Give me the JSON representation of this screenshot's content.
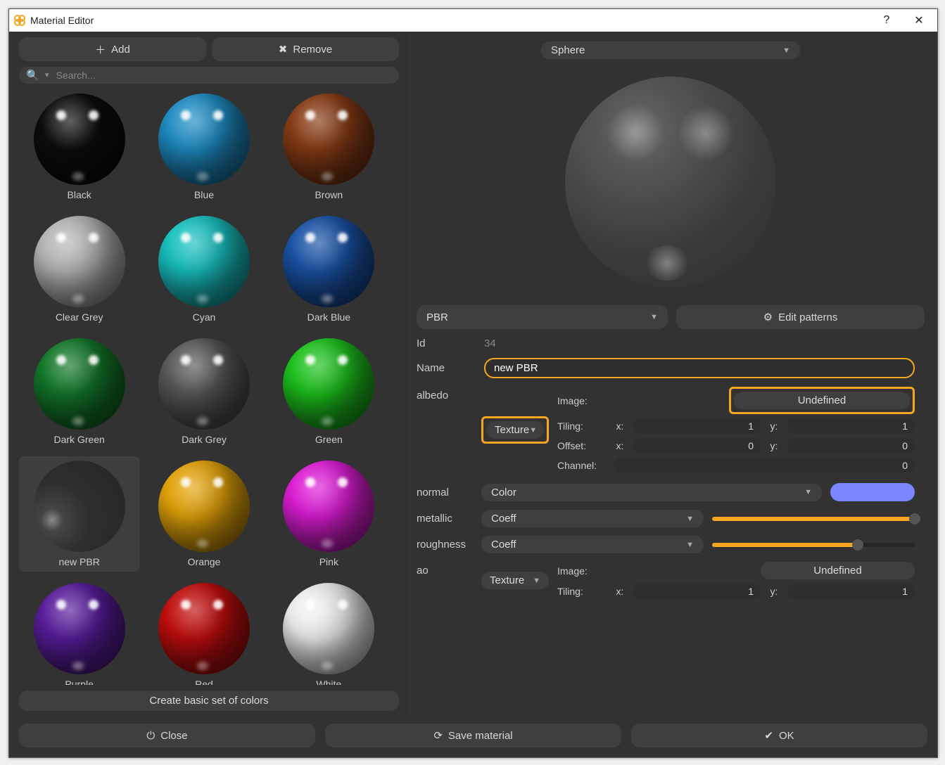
{
  "window": {
    "title": "Material Editor"
  },
  "left": {
    "add_label": "Add",
    "remove_label": "Remove",
    "search_placeholder": "Search...",
    "create_label": "Create basic set of colors",
    "materials": [
      {
        "name": "Black",
        "color": "#0d0d0d",
        "selected": false
      },
      {
        "name": "Blue",
        "color": "#1f8ec6",
        "selected": false
      },
      {
        "name": "Brown",
        "color": "#8a3d16",
        "selected": false
      },
      {
        "name": "Clear Grey",
        "color": "#b9b9b9",
        "selected": false
      },
      {
        "name": "Cyan",
        "color": "#19c3c3",
        "selected": false
      },
      {
        "name": "Dark Blue",
        "color": "#1a54a8",
        "selected": false
      },
      {
        "name": "Dark Green",
        "color": "#147a2a",
        "selected": false
      },
      {
        "name": "Dark Grey",
        "color": "#5a5a5a",
        "selected": false
      },
      {
        "name": "Green",
        "color": "#1ec41e",
        "selected": false
      },
      {
        "name": "new PBR",
        "color": "#3a3a3a",
        "selected": true,
        "matte": true
      },
      {
        "name": "Orange",
        "color": "#e5a50a",
        "selected": false
      },
      {
        "name": "Pink",
        "color": "#e01ed8",
        "selected": false
      },
      {
        "name": "Purple",
        "color": "#5a1e9e",
        "selected": false
      },
      {
        "name": "Red",
        "color": "#c40e0e",
        "selected": false
      },
      {
        "name": "White",
        "color": "#f2f2f2",
        "selected": false
      }
    ]
  },
  "right": {
    "preview_shape": "Sphere",
    "material_type": "PBR",
    "edit_patterns_label": "Edit patterns",
    "id_label": "Id",
    "id_value": "34",
    "name_label": "Name",
    "name_value": "new PBR",
    "albedo": {
      "label": "albedo",
      "mode": "Texture",
      "image_label": "Image:",
      "image_value": "Undefined",
      "tiling_label": "Tiling:",
      "tiling_x": "1",
      "tiling_y": "1",
      "offset_label": "Offset:",
      "offset_x": "0",
      "offset_y": "0",
      "channel_label": "Channel:",
      "channel": "0"
    },
    "normal": {
      "label": "normal",
      "mode": "Color",
      "color": "#7a85ff"
    },
    "metallic": {
      "label": "metallic",
      "mode": "Coeff",
      "value": 1.0
    },
    "roughness": {
      "label": "roughness",
      "mode": "Coeff",
      "value": 0.72
    },
    "ao": {
      "label": "ao",
      "mode": "Texture",
      "image_label": "Image:",
      "image_value": "Undefined",
      "tiling_label": "Tiling:",
      "tiling_x": "1",
      "tiling_y": "1"
    }
  },
  "footer": {
    "close_label": "Close",
    "save_label": "Save material",
    "ok_label": "OK"
  }
}
